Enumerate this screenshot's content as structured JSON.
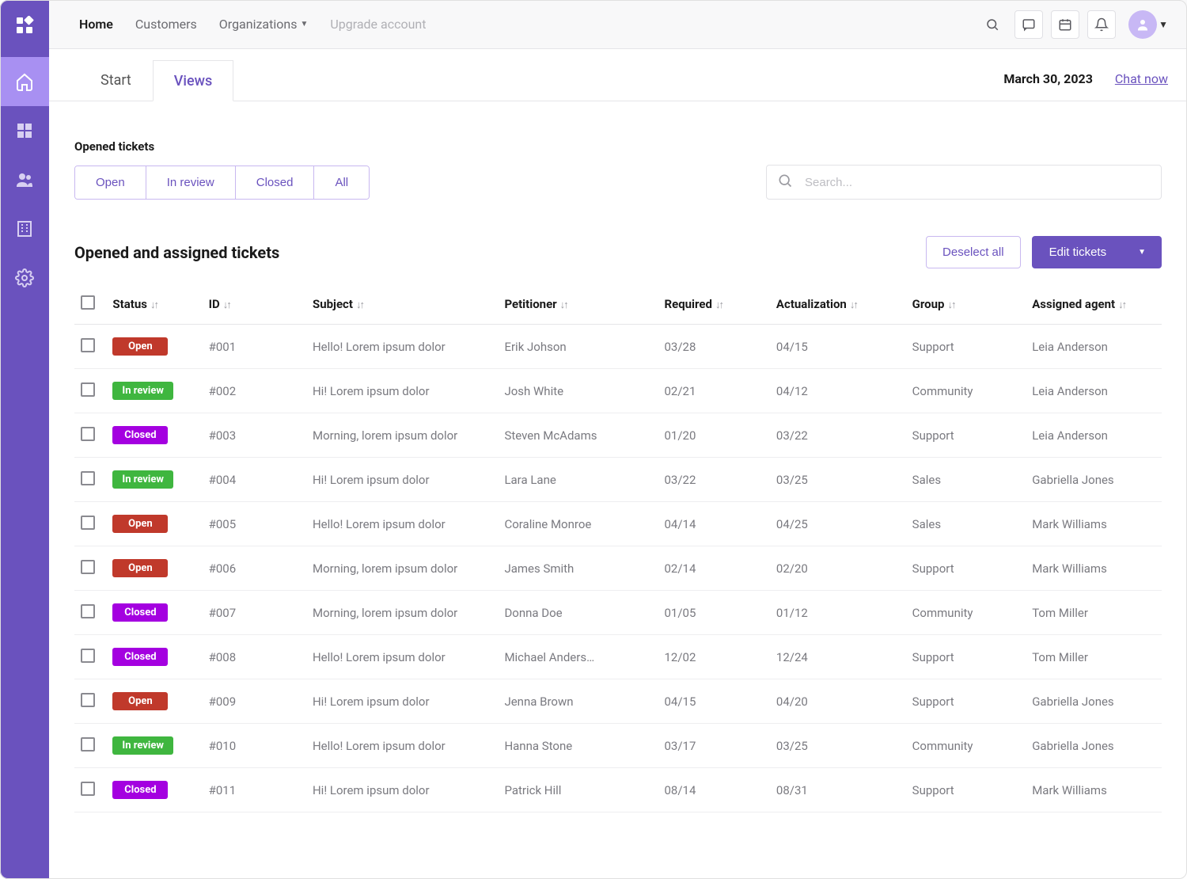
{
  "topnav": {
    "home": "Home",
    "customers": "Customers",
    "organizations": "Organizations",
    "upgrade": "Upgrade account"
  },
  "subheader": {
    "tabs": {
      "start": "Start",
      "views": "Views"
    },
    "date": "March 30, 2023",
    "chat": "Chat now"
  },
  "filters": {
    "section_label": "Opened tickets",
    "open": "Open",
    "in_review": "In review",
    "closed": "Closed",
    "all": "All"
  },
  "search": {
    "placeholder": "Search..."
  },
  "table": {
    "title": "Opened and assigned tickets",
    "actions": {
      "deselect": "Deselect all",
      "edit": "Edit tickets"
    },
    "columns": {
      "status": "Status",
      "id": "ID",
      "subject": "Subject",
      "petitioner": "Petitioner",
      "required": "Required",
      "actualization": "Actualization",
      "group": "Group",
      "agent": "Assigned agent"
    },
    "rows": [
      {
        "status": "Open",
        "status_class": "open",
        "id": "#001",
        "subject": "Hello! Lorem ipsum dolor",
        "petitioner": "Erik Johson",
        "required": "03/28",
        "actualization": "04/15",
        "group": "Support",
        "agent": "Leia Anderson"
      },
      {
        "status": "In review",
        "status_class": "in-review",
        "id": "#002",
        "subject": "Hi! Lorem ipsum dolor",
        "petitioner": "Josh White",
        "required": "02/21",
        "actualization": "04/12",
        "group": "Community",
        "agent": "Leia Anderson"
      },
      {
        "status": "Closed",
        "status_class": "closed",
        "id": "#003",
        "subject": "Morning, lorem ipsum dolor",
        "petitioner": "Steven McAdams",
        "required": "01/20",
        "actualization": "03/22",
        "group": "Support",
        "agent": "Leia Anderson"
      },
      {
        "status": "In review",
        "status_class": "in-review",
        "id": "#004",
        "subject": "Hi! Lorem ipsum dolor",
        "petitioner": "Lara Lane",
        "required": "03/22",
        "actualization": "03/25",
        "group": "Sales",
        "agent": "Gabriella Jones"
      },
      {
        "status": "Open",
        "status_class": "open",
        "id": "#005",
        "subject": "Hello! Lorem ipsum dolor",
        "petitioner": "Coraline Monroe",
        "required": "04/14",
        "actualization": "04/25",
        "group": "Sales",
        "agent": "Mark Williams"
      },
      {
        "status": "Open",
        "status_class": "open",
        "id": "#006",
        "subject": "Morning, lorem ipsum dolor",
        "petitioner": "James Smith",
        "required": "02/14",
        "actualization": "02/20",
        "group": "Support",
        "agent": "Mark Williams"
      },
      {
        "status": "Closed",
        "status_class": "closed",
        "id": "#007",
        "subject": "Morning, lorem ipsum dolor",
        "petitioner": "Donna Doe",
        "required": "01/05",
        "actualization": "01/12",
        "group": "Community",
        "agent": "Tom Miller"
      },
      {
        "status": "Closed",
        "status_class": "closed",
        "id": "#008",
        "subject": "Hello! Lorem ipsum dolor",
        "petitioner": "Michael Anders…",
        "required": "12/02",
        "actualization": "12/24",
        "group": "Support",
        "agent": "Tom Miller"
      },
      {
        "status": "Open",
        "status_class": "open",
        "id": "#009",
        "subject": "Hi! Lorem ipsum dolor",
        "petitioner": "Jenna Brown",
        "required": "04/15",
        "actualization": "04/20",
        "group": "Support",
        "agent": "Gabriella Jones"
      },
      {
        "status": "In review",
        "status_class": "in-review",
        "id": "#010",
        "subject": "Hello! Lorem ipsum dolor",
        "petitioner": "Hanna Stone",
        "required": "03/17",
        "actualization": "03/25",
        "group": "Community",
        "agent": "Gabriella Jones"
      },
      {
        "status": "Closed",
        "status_class": "closed",
        "id": "#011",
        "subject": "Hi! Lorem ipsum dolor",
        "petitioner": "Patrick Hill",
        "required": "08/14",
        "actualization": "08/31",
        "group": "Support",
        "agent": "Mark Williams"
      }
    ]
  }
}
